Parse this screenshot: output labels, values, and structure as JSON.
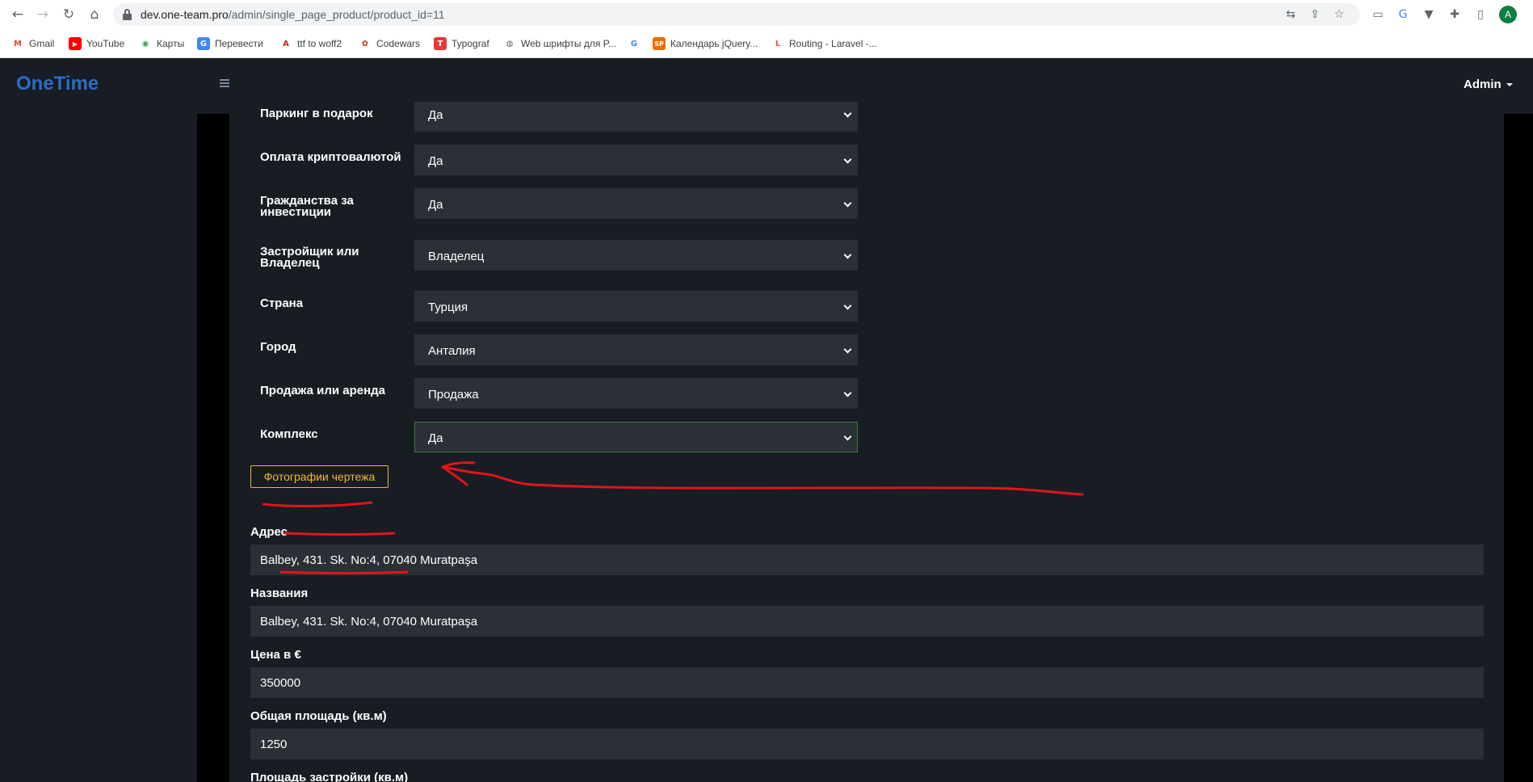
{
  "browser": {
    "url_host": "dev.one-team.pro",
    "url_path": "/admin/single_page_product/product_id=11",
    "profile_initial": "A",
    "bookmarks": [
      {
        "label": "Gmail",
        "icon": "gmail-icon",
        "color": "#ea4335",
        "glyph": "M"
      },
      {
        "label": "YouTube",
        "icon": "youtube-icon",
        "color": "#ff0000",
        "glyph": "▶"
      },
      {
        "label": "Карты",
        "icon": "maps-icon",
        "color": "#34a853",
        "glyph": "◉"
      },
      {
        "label": "Перевести",
        "icon": "translate-icon",
        "color": "#4285f4",
        "glyph": "G"
      },
      {
        "label": "ttf to woff2",
        "icon": "font-converter-icon",
        "color": "#c62828",
        "glyph": "A"
      },
      {
        "label": "Codewars",
        "icon": "codewars-icon",
        "color": "#b1361e",
        "glyph": "✿"
      },
      {
        "label": "Typograf",
        "icon": "typograf-icon",
        "color": "#e53935",
        "glyph": "T"
      },
      {
        "label": "Web шрифты для P...",
        "icon": "globe-icon",
        "color": "#5f6368",
        "glyph": "◍"
      },
      {
        "label": "",
        "icon": "google-icon",
        "color": "#4285f4",
        "glyph": "G"
      },
      {
        "label": "Календарь jQuery...",
        "icon": "sp-icon",
        "color": "#ef6c00",
        "glyph": "SP"
      },
      {
        "label": "Routing - Laravel -...",
        "icon": "laravel-icon",
        "color": "#f05340",
        "glyph": "L"
      }
    ]
  },
  "app": {
    "brand": "OneTime",
    "user": "Admin"
  },
  "form": {
    "selects": [
      {
        "label": "Паркинг в подарок",
        "value": "Да"
      },
      {
        "label": "Оплата криптовалютой",
        "value": "Да"
      },
      {
        "label": "Гражданства за инвестиции",
        "value": "Да"
      },
      {
        "label": "Застройщик или Владелец",
        "value": "Владелец"
      },
      {
        "label": "Страна",
        "value": "Турция"
      },
      {
        "label": "Город",
        "value": "Анталия"
      },
      {
        "label": "Продажа или аренда",
        "value": "Продажа"
      },
      {
        "label": "Комплекс",
        "value": "Да"
      }
    ],
    "photo_button": "Фотографии чертежа",
    "fields": [
      {
        "label": "Адрес",
        "value": "Balbey, 431. Sk. No:4, 07040 Muratpaşa"
      },
      {
        "label": "Названия",
        "value": "Balbey, 431. Sk. No:4, 07040 Muratpaşa"
      },
      {
        "label": "Цена в €",
        "value": "350000"
      },
      {
        "label": "Общая площадь (кв.м)",
        "value": "1250"
      },
      {
        "label": "Площадь застройки (кв.м)",
        "value": ""
      }
    ]
  },
  "colors": {
    "accent_orange": "#f5b43a",
    "brand_blue": "#2b6cc4",
    "annotation_red": "#e0141c"
  }
}
